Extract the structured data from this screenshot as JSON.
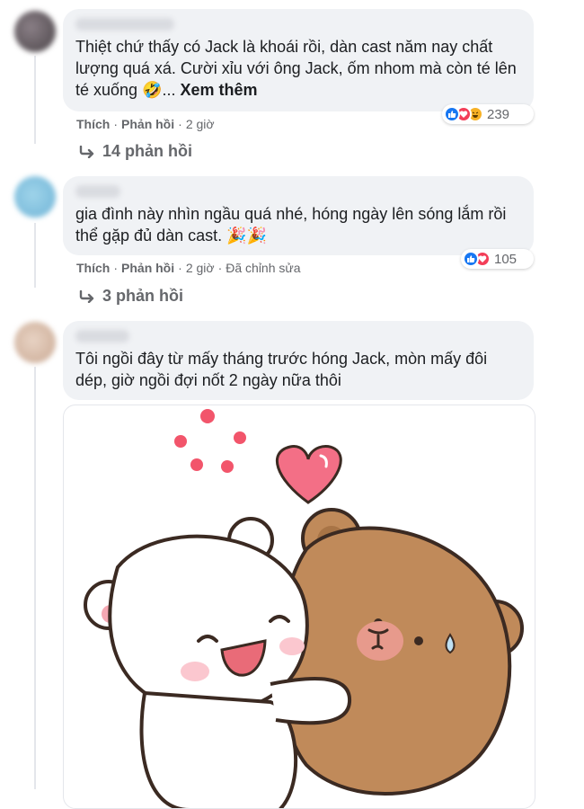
{
  "comments": [
    {
      "text": "Thiệt chứ thấy có Jack là khoái rồi, dàn cast năm nay chất lượng quá xá. Cười xỉu với ông Jack, ốm nhom mà còn té lên té xuống 🤣...",
      "see_more": "Xem thêm",
      "like": "Thích",
      "reply": "Phản hồi",
      "time": "2 giờ",
      "edited": "",
      "reaction_count": "239",
      "reaction_icons": [
        "like-icon",
        "love-icon",
        "haha-icon"
      ],
      "replies_label": "14 phản hồi"
    },
    {
      "text": "gia đình này nhìn ngầu quá nhé, hóng ngày lên sóng lắm rồi thể gặp đủ dàn cast. 🎉🎉",
      "like": "Thích",
      "reply": "Phản hồi",
      "time": "2 giờ",
      "edited": "Đã chỉnh sửa",
      "reaction_count": "105",
      "reaction_icons": [
        "like-icon",
        "love-icon"
      ],
      "replies_label": "3 phản hồi"
    },
    {
      "text": "Tôi ngồi đây từ mấy tháng trước hóng Jack, mòn mấy đôi dép, giờ ngồi đợi nốt 2 ngày nữa thôi",
      "sticker": "hugging-bears-sticker"
    }
  ],
  "colors": {
    "bubble": "#f0f2f5",
    "meta_text": "#65676b",
    "like_blue": "#1877f2",
    "love_red": "#f33e58",
    "haha_yellow": "#f7b125"
  }
}
